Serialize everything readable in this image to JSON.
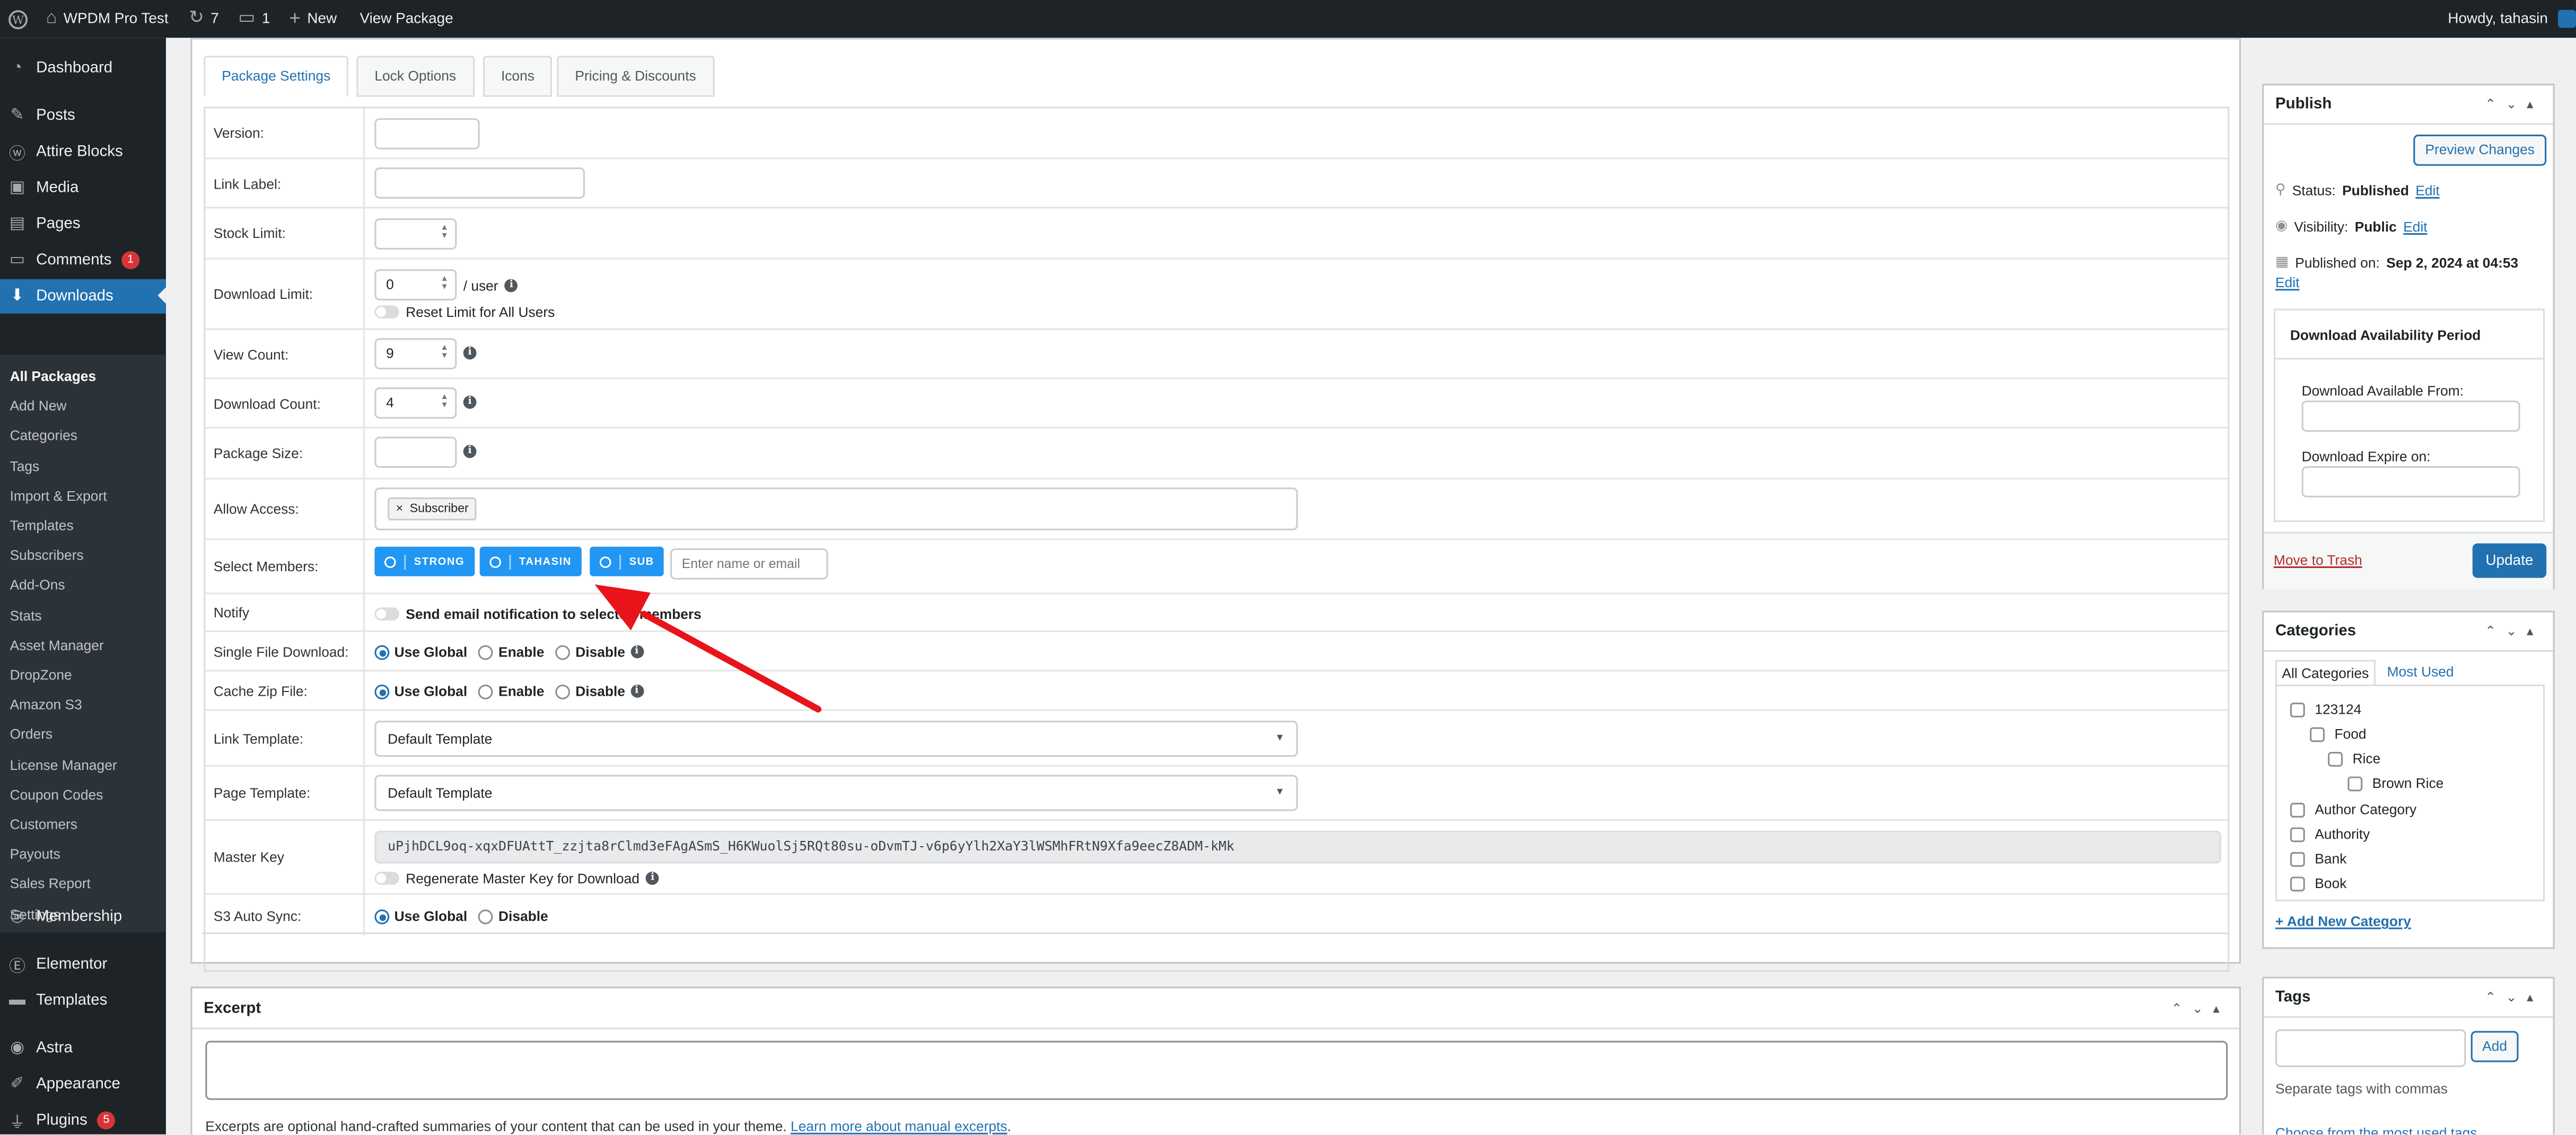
{
  "adminbar": {
    "site_name": "WPDM Pro Test",
    "updates_count": "7",
    "comments_count": "1",
    "new_label": "New",
    "view_package": "View Package",
    "howdy": "Howdy, tahasin"
  },
  "sidebar": {
    "items": [
      {
        "label": "Dashboard",
        "icon": "dashboard-icon"
      },
      {
        "label": "Posts",
        "icon": "pin-icon"
      },
      {
        "label": "Attire Blocks",
        "icon": "wordpress-icon"
      },
      {
        "label": "Media",
        "icon": "media-icon"
      },
      {
        "label": "Pages",
        "icon": "pages-icon"
      },
      {
        "label": "Comments",
        "icon": "comment-icon",
        "badge": "1"
      },
      {
        "label": "Downloads",
        "icon": "download-icon"
      },
      {
        "label": "Membership",
        "icon": "membership-icon"
      },
      {
        "label": "Elementor",
        "icon": "elementor-icon"
      },
      {
        "label": "Templates",
        "icon": "folder-icon"
      },
      {
        "label": "Astra",
        "icon": "astra-icon"
      },
      {
        "label": "Appearance",
        "icon": "brush-icon"
      },
      {
        "label": "Plugins",
        "icon": "plugin-icon",
        "badge": "5"
      }
    ],
    "submenu": [
      "All Packages",
      "Add New",
      "Categories",
      "Tags",
      "Import & Export",
      "Templates",
      "Subscribers",
      "Add-Ons",
      "Stats",
      "Asset Manager",
      "DropZone",
      "Amazon S3",
      "Orders",
      "License Manager",
      "Coupon Codes",
      "Customers",
      "Payouts",
      "Sales Report",
      "Settings"
    ]
  },
  "tabs": [
    "Package Settings",
    "Lock Options",
    "Icons",
    "Pricing & Discounts"
  ],
  "settings": {
    "version_label": "Version:",
    "link_label_label": "Link Label:",
    "stock_limit_label": "Stock Limit:",
    "download_limit_label": "Download Limit:",
    "download_limit_value": "0",
    "per_user": "/ user",
    "reset_limit": "Reset Limit for All Users",
    "view_count_label": "View Count:",
    "view_count_value": "9",
    "download_count_label": "Download Count:",
    "download_count_value": "4",
    "package_size_label": "Package Size:",
    "allow_access_label": "Allow Access:",
    "allow_access_tag": "Subscriber",
    "select_members_label": "Select Members:",
    "members": [
      "STRONG",
      "TAHASIN",
      "SUB"
    ],
    "member_placeholder": "Enter name or email",
    "notify_label": "Notify",
    "notify_text": "Send email notification to selected members",
    "single_file_label": "Single File Download:",
    "cache_zip_label": "Cache Zip File:",
    "opt_use_global": "Use Global",
    "opt_enable": "Enable",
    "opt_disable": "Disable",
    "link_template_label": "Link Template:",
    "link_template_value": "Default Template",
    "page_template_label": "Page Template:",
    "page_template_value": "Default Template",
    "master_key_label": "Master Key",
    "master_key_value": "uPjhDCL9oq-xqxDFUAttT_zzjta8rClmd3eFAgASmS_H6KWuolSj5RQt80su-oDvmTJ-v6p6yYlh2XaY3lWSMhFRtN9Xfa9eecZ8ADM-kMk",
    "regenerate_text": "Regenerate Master Key for Download",
    "s3_label": "S3 Auto Sync:"
  },
  "excerpt": {
    "title": "Excerpt",
    "help": "Excerpts are optional hand-crafted summaries of your content that can be used in your theme.",
    "help_link": "Learn more about manual excerpts"
  },
  "publish": {
    "title": "Publish",
    "preview": "Preview Changes",
    "status_label": "Status:",
    "status_value": "Published",
    "visibility_label": "Visibility:",
    "visibility_value": "Public",
    "published_label": "Published on:",
    "published_value": "Sep 2, 2024 at 04:53",
    "edit": "Edit",
    "availability_title": "Download Availability Period",
    "available_from": "Download Available From:",
    "expire_on": "Download Expire on:",
    "trash": "Move to Trash",
    "update": "Update"
  },
  "categories": {
    "title": "Categories",
    "tab_all": "All Categories",
    "tab_used": "Most Used",
    "items": [
      "123124",
      "Food",
      "Rice",
      "Brown Rice",
      "Author Category",
      "Authority",
      "Bank",
      "Book"
    ],
    "add_new": "+ Add New Category"
  },
  "tags": {
    "title": "Tags",
    "add": "Add",
    "help": "Separate tags with commas",
    "choose": "Choose from the most used tags"
  },
  "colors": {
    "accent": "#2271b1",
    "chip": "#2196f3",
    "arrow": "#e8141a",
    "admin_bg": "#1d2327"
  }
}
